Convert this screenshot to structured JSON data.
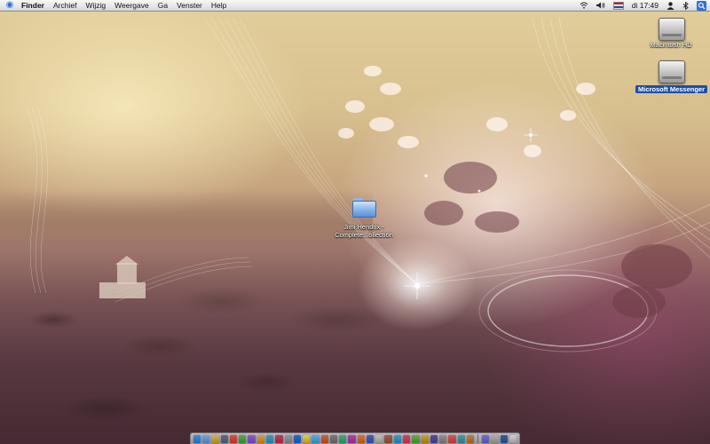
{
  "menubar": {
    "apple_icon": "apple-logo-icon",
    "app_name": "Finder",
    "menus": [
      "Archief",
      "Wijzig",
      "Weergave",
      "Ga",
      "Venster",
      "Help"
    ],
    "status": {
      "clock": "di 17:49",
      "icons": [
        "wifi-icon",
        "volume-icon",
        "flag-nl-icon",
        "user-icon",
        "bluetooth-icon",
        "spotlight-icon"
      ]
    }
  },
  "desktop": {
    "items": [
      {
        "label": "Macintosh HD",
        "icon": "hard-drive-icon"
      },
      {
        "label": "Microsoft Messenger",
        "icon": "disk-image-icon"
      },
      {
        "label_line1": "Jimi Hendrix -",
        "label_line2": "Complete...ollection",
        "icon": "folder-icon"
      }
    ]
  },
  "dock": {
    "icon_colors": [
      "#3a8fe0",
      "#6aa7e8",
      "#d9b24a",
      "#5a6e8a",
      "#e04a3a",
      "#4ab04a",
      "#8a5ad0",
      "#e0a030",
      "#3aa0c0",
      "#c03a5a",
      "#9a9a9a",
      "#2a6ad0",
      "#e0d040",
      "#50b0e0",
      "#d06030",
      "#7a7a7a",
      "#3ab080",
      "#b040b0",
      "#e07030",
      "#4060c0",
      "#c0c0c0",
      "#a06040",
      "#30a0d0",
      "#e04060",
      "#60b040",
      "#d0a020",
      "#5050a0",
      "#909090",
      "#e05050",
      "#40a0a0",
      "#c08030",
      "#7070d0",
      "#b0b0b0",
      "#3060a0",
      "#d0d0d0"
    ]
  },
  "colors": {
    "selection": "#1d4fa8",
    "folder": "#7fb0e8",
    "spotlight": "#2f6fd6"
  }
}
